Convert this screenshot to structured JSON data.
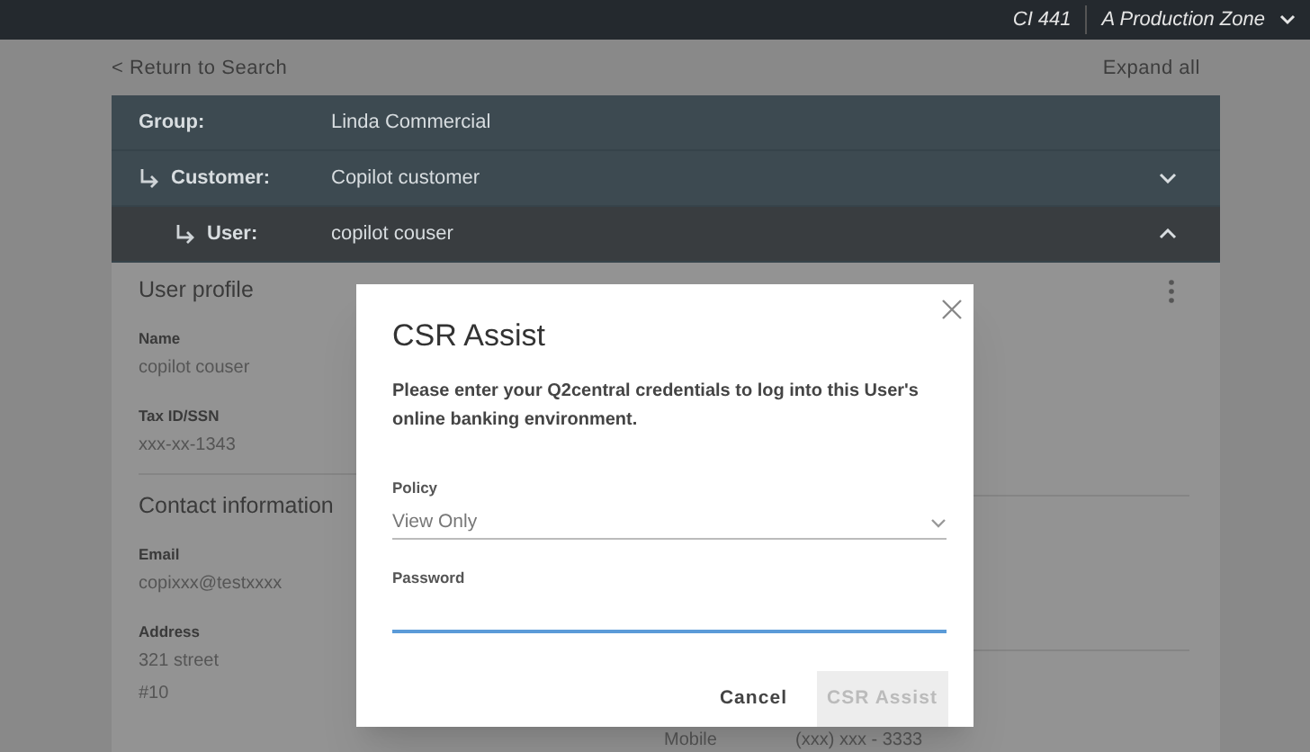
{
  "top_bar": {
    "code": "CI 441",
    "zone": "A Production Zone"
  },
  "nav": {
    "back": "< Return to Search",
    "expand": "Expand all"
  },
  "hierarchy": [
    {
      "label": "Group:",
      "value": "Linda Commercial",
      "selected": false,
      "children": [
        {
          "label": "Customer:",
          "value": "Copilot customer",
          "selected": false,
          "expanded": false,
          "children": [
            {
              "label": "User:",
              "value": "copilot couser",
              "selected": true,
              "expanded": true
            }
          ]
        }
      ]
    }
  ],
  "profile": {
    "title": "User profile",
    "fields": [
      {
        "label": "Name",
        "lines": [
          "copilot couser"
        ]
      },
      {
        "label": "Tax ID/SSN",
        "lines": [
          "xxx-xx-1343"
        ]
      }
    ]
  },
  "contact": {
    "title": "Contact information",
    "fields": [
      {
        "label": "Email",
        "lines": [
          "copixxx@testxxxx"
        ]
      },
      {
        "label": "Address",
        "lines": [
          "321 street",
          "#10"
        ]
      }
    ]
  },
  "phones": [
    {
      "label": "Mobile",
      "value": "(xxx) xxx - 3333"
    }
  ],
  "dialog": {
    "title": "CSR Assist",
    "message": "Please enter your Q2central credentials to log into this User's online banking environment.",
    "policy": {
      "label": "Policy",
      "value": "View Only"
    },
    "password": {
      "label": "Password",
      "focused": true
    },
    "buttons": [
      {
        "label": "Cancel",
        "disabled": false
      },
      {
        "label": "CSR Assist",
        "disabled": true
      }
    ]
  }
}
